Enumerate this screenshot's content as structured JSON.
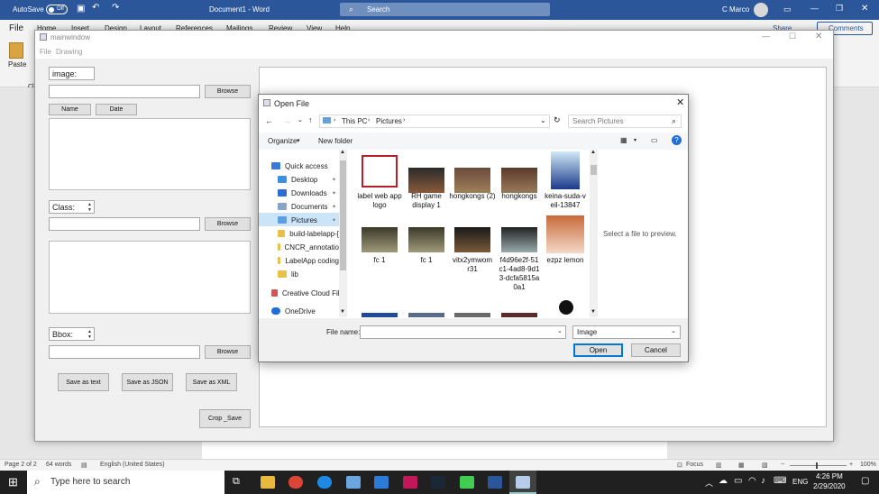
{
  "word": {
    "autosave_label": "AutoSave",
    "autosave_state": "Off",
    "doc_title": "Document1 - Word",
    "search_placeholder": "Search",
    "user": "C Marco",
    "ribbon_tabs": [
      "File",
      "Home",
      "Insert",
      "Design",
      "Layout",
      "References",
      "Mailings",
      "Review",
      "View",
      "Help"
    ],
    "share_label": "Share",
    "comments_label": "Comments",
    "paste_label": "Paste",
    "clipboard_short": "Cl",
    "status": {
      "page": "Page 2 of 2",
      "words": "64 words",
      "language": "English (United States)",
      "focus": "Focus",
      "zoom": "100%"
    }
  },
  "mainwindow": {
    "title": "mainwindow",
    "menu": [
      "File",
      "Drawing"
    ],
    "image_label": "image:",
    "browse1": "Browse",
    "name_btn": "Name",
    "date_btn": "Date",
    "class_label": "Class:",
    "browse2": "Browse",
    "bbox_label": "Bbox:",
    "browse3": "Browse",
    "save_text": "Save as text",
    "save_json": "Save as JSON",
    "save_xml": "Save as XML",
    "crop_save": "Crop _Save"
  },
  "dialog": {
    "title": "Open File",
    "breadcrumb": [
      "This PC",
      "Pictures"
    ],
    "search_placeholder": "Search Pictures",
    "organize": "Organize",
    "new_folder": "New folder",
    "nav": [
      "Quick access",
      "Desktop",
      "Downloads",
      "Documents",
      "Pictures",
      "build-labelapp-[",
      "CNCR_annotatio",
      "LabelApp coding",
      "lib",
      "Creative Cloud File",
      "OneDrive"
    ],
    "files": [
      "label web app logo",
      "RH game display 1",
      "hongkongs (2)",
      "hongkongs",
      "keina-suda-v eil-13847",
      "fc 1",
      "fc 1",
      "vitx2ymwom r31",
      "f4d96e2f-51 c1-4ad8-9d1 3-dcfa5815a 0a1",
      "ezpz lemon"
    ],
    "preview_text": "Select a file to preview.",
    "filename_label": "File name:",
    "filename_value": "",
    "filter_value": "Image",
    "open_btn": "Open",
    "cancel_btn": "Cancel"
  },
  "taskbar": {
    "search_placeholder": "Type here to search",
    "lang": "ENG",
    "time": "4:26 PM",
    "date": "2/29/2020"
  }
}
